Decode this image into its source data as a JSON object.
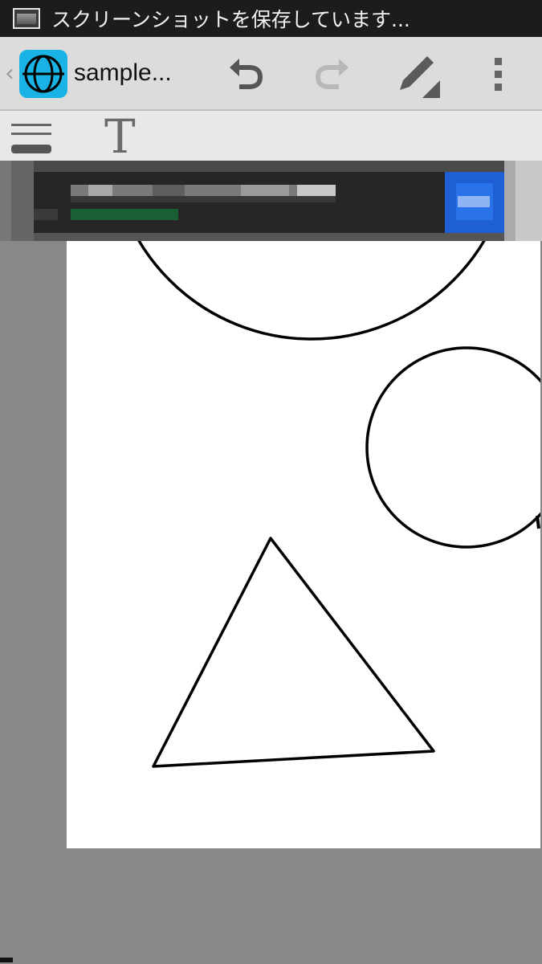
{
  "status_bar": {
    "icon": "screenshot-icon",
    "text": "スクリーンショットを保存しています..."
  },
  "action_bar": {
    "back_icon": "chevron-left-icon",
    "back_glyph": "‹",
    "app_icon": "app-logo-icon",
    "title": "sample...",
    "buttons": [
      {
        "name": "undo",
        "icon": "undo-icon"
      },
      {
        "name": "redo",
        "icon": "redo-icon"
      },
      {
        "name": "pen",
        "icon": "pencil-icon"
      },
      {
        "name": "overflow",
        "icon": "overflow-menu-icon"
      }
    ]
  },
  "tool_strip": {
    "menu_icon": "hamburger-menu-icon",
    "text_tool_glyph": "T"
  },
  "canvas": {
    "shapes": [
      "circle",
      "circle",
      "triangle"
    ]
  },
  "colors": {
    "status_bar": "#1c1c1c",
    "action_bar": "#dcdcdc",
    "app_icon": "#1ab3e6",
    "workspace": "#888888",
    "page": "#ffffff"
  }
}
